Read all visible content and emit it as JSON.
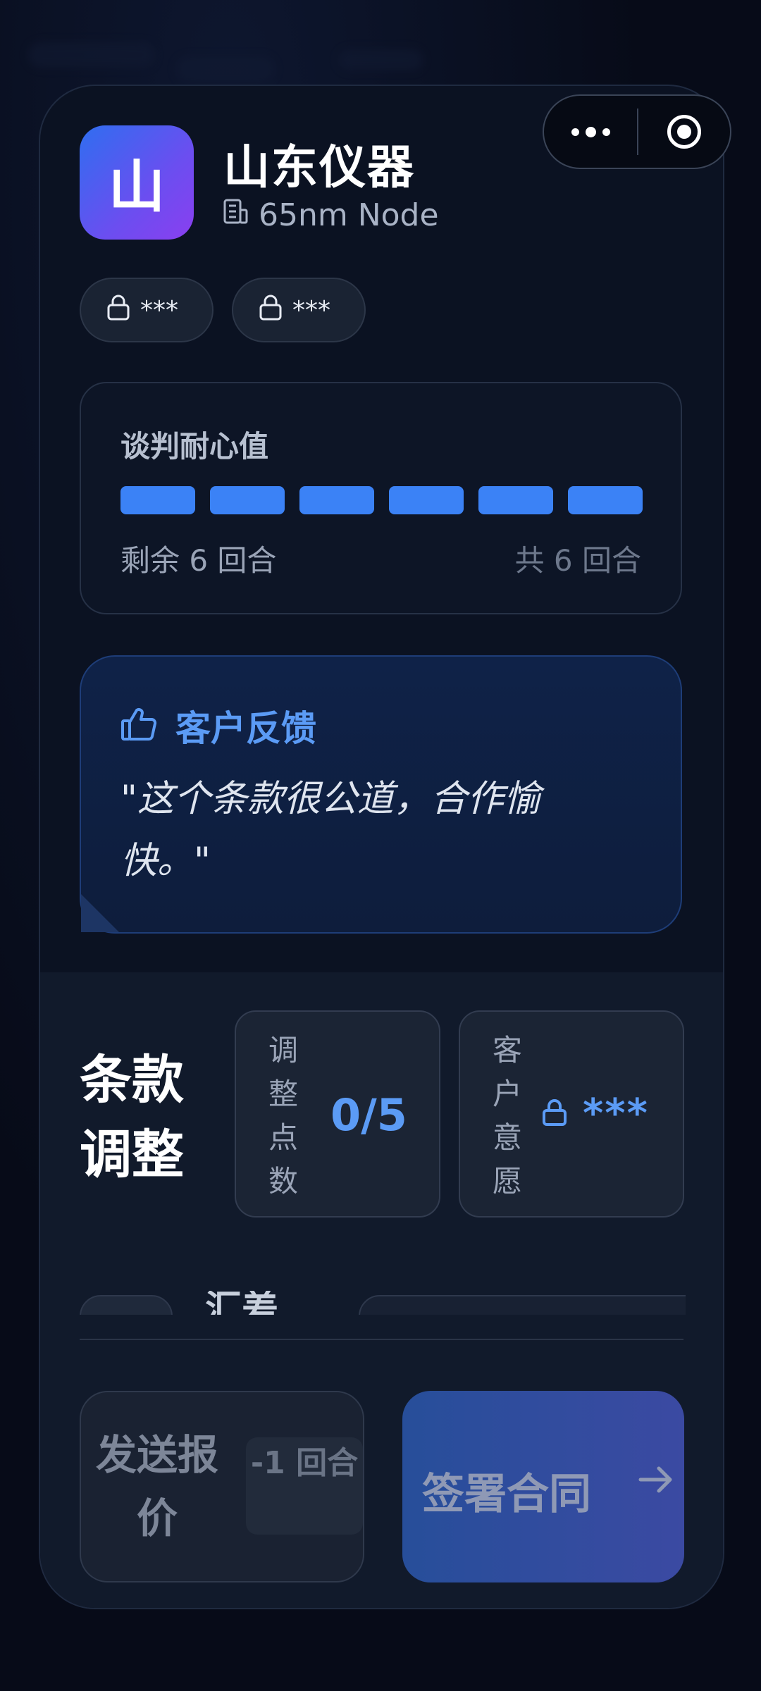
{
  "company": {
    "avatar_char": "山",
    "name": "山东仪器",
    "node": "65nm Node"
  },
  "tags": [
    "***",
    "***"
  ],
  "patience": {
    "title": "谈判耐心值",
    "segments_filled": 6,
    "segments_total": 6,
    "remaining_text": "剩余 6 回合",
    "total_text": "共 6 回合"
  },
  "feedback": {
    "title": "客户反馈",
    "quote": "\"这个条款很公道，合作愉快。\""
  },
  "terms": {
    "title": "条款调整",
    "points_label": "调整点数",
    "points_value": "0/5",
    "willingness_label": "客户意愿",
    "willingness_value": "***",
    "peek_text": "汇差"
  },
  "actions": {
    "send_label": "发送报价",
    "send_cost": "-1 回合",
    "sign_label": "签署合同"
  },
  "colors": {
    "accent": "#3b82f6",
    "accent_text": "#5b9bf5"
  }
}
